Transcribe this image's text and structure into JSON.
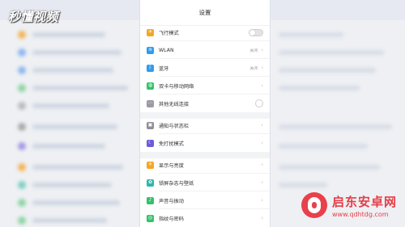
{
  "watermark": "秒懂视频",
  "settings": {
    "title": "设置",
    "rows": [
      {
        "label": "飞行模式",
        "icon": "airplane-icon",
        "color": "#f5a623",
        "glyph": "✈",
        "control": "toggle",
        "toggle_on": false
      },
      {
        "label": "WLAN",
        "icon": "wifi-icon",
        "color": "#2d9cf0",
        "glyph": "≋",
        "value": "关闭",
        "control": "chevron"
      },
      {
        "label": "蓝牙",
        "icon": "bluetooth-icon",
        "color": "#2d9cf0",
        "glyph": "ᛒ",
        "value": "关闭",
        "control": "chevron"
      },
      {
        "label": "双卡与移动网络",
        "icon": "sim-icon",
        "color": "#34c26b",
        "glyph": "◍",
        "control": "chevron"
      },
      {
        "label": "其他无线连接",
        "icon": "wireless-icon",
        "color": "#9b9ba6",
        "glyph": "⋯",
        "control": "radio"
      },
      {
        "label": "通知与状态栏",
        "icon": "notification-icon",
        "color": "#8e8e98",
        "glyph": "▣",
        "control": "chevron"
      },
      {
        "label": "免打扰模式",
        "icon": "moon-icon",
        "color": "#6a5cd8",
        "glyph": "☾",
        "control": "chevron"
      },
      {
        "label": "显示与亮度",
        "icon": "display-icon",
        "color": "#f5a623",
        "glyph": "☀",
        "control": "chevron"
      },
      {
        "label": "锁屏杂志与壁纸",
        "icon": "wallpaper-icon",
        "color": "#2db7a8",
        "glyph": "✿",
        "control": "chevron"
      },
      {
        "label": "声音与振动",
        "icon": "sound-icon",
        "color": "#34c26b",
        "glyph": "♪",
        "control": "chevron"
      },
      {
        "label": "指纹与密码",
        "icon": "fingerprint-icon",
        "color": "#34c26b",
        "glyph": "◎",
        "control": "chevron"
      }
    ]
  },
  "brand": {
    "name": "启东安卓网",
    "url": "www.qdhtdg.com",
    "color": "#e63d47"
  }
}
